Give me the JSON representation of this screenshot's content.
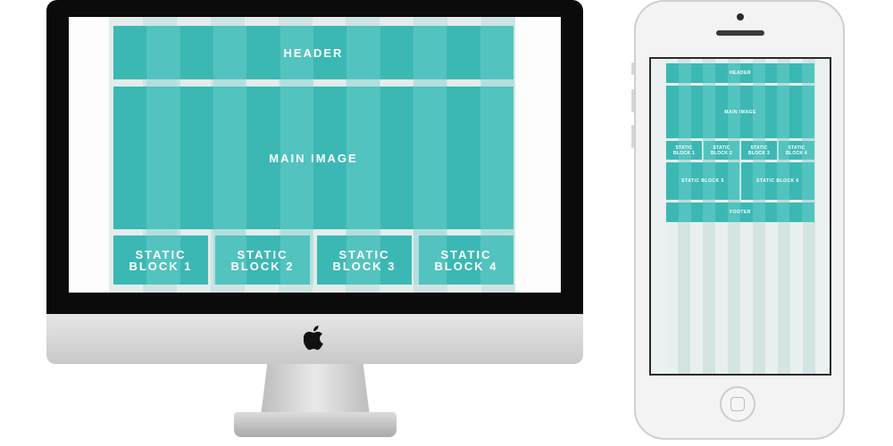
{
  "desktop": {
    "header_label": "HEADER",
    "main_label": "MAIN IMAGE",
    "blocks": [
      "STATIC BLOCK 1",
      "STATIC BLOCK 2",
      "STATIC BLOCK 3",
      "STATIC BLOCK 4"
    ]
  },
  "mobile": {
    "header_label": "HEADER",
    "main_label": "MAIN IMAGE",
    "blocks_row1": [
      "STATIC BLOCK 1",
      "STATIC BLOCK 2",
      "STATIC BLOCK 3",
      "STATIC BLOCK 4"
    ],
    "blocks_row2": [
      "STATIC BLOCK 5",
      "STATIC BLOCK 6"
    ],
    "footer_label": "FOOTER"
  },
  "colors": {
    "tile": "#3cb8b4",
    "column": "#56c9c6",
    "gutter": "#dfe9e8"
  }
}
